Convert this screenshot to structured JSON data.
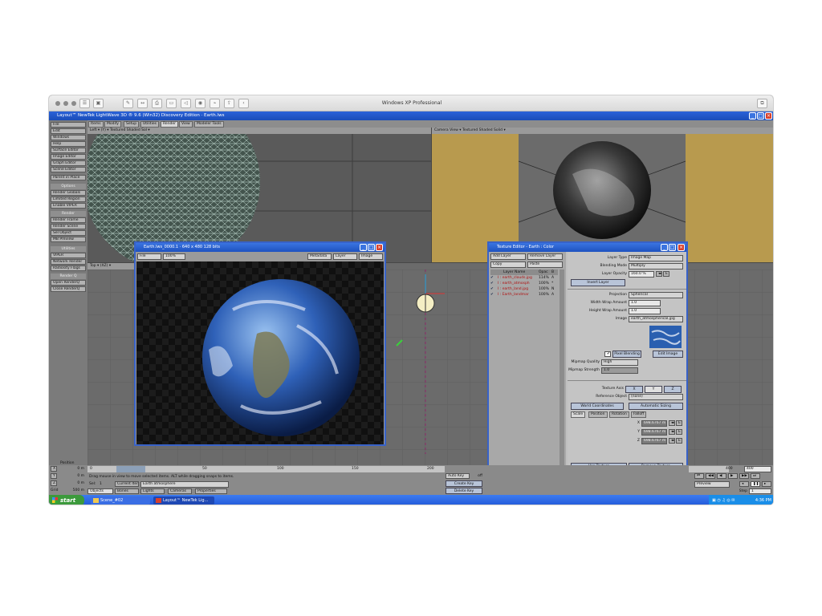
{
  "mac": {
    "title": "Windows XP Professional"
  },
  "app": {
    "title": "Layout™ NewTek LightWave 3D ® 9.6 (Win32) Discovery Edition · Earth.lws"
  },
  "tabs": [
    "Items",
    "Modify",
    "Setup",
    "Utilities",
    "Render",
    "View",
    "Modeler Tools"
  ],
  "sidebar": {
    "menus": [
      "File",
      "Edit",
      "Windows",
      "Help"
    ],
    "edit_items": [
      "Surface Editor",
      "Image Editor",
      "Graph Editor",
      "Scene Editor"
    ],
    "parent_in_place": "Parent in Place",
    "options_header": "Options",
    "options": [
      "Render Globals",
      "Limited Region",
      "Enable VIPER"
    ],
    "render_header": "Render",
    "render": [
      "Render Frame",
      "Render Scene",
      "Sel Object",
      "MB Preview"
    ],
    "utilities_header": "Utilities",
    "utilities": [
      "VIPER",
      "Network Render",
      "Radiosity Flags"
    ],
    "renderq_header": "Render Q",
    "renderq": [
      "Open RenderQ",
      "Close RenderQ"
    ]
  },
  "viewports": {
    "tl_view": "Left",
    "tl_axis": "(Y)",
    "tl_mode": "Textured Shaded Sol",
    "tr_view": "Camera View",
    "tr_mode": "Textured Shaded Solid",
    "bl_view": "Top",
    "bl_axis": "(XZ)"
  },
  "render_window": {
    "title": "Earth.lws_0000.1 · 640 x 480 128 bits",
    "file": "File",
    "zoom": "100%",
    "metadata": "Metadata",
    "layer": "Layer",
    "image": "Image"
  },
  "texture_editor": {
    "title": "Texture Editor - Earth : Color",
    "add_layer": "Add Layer",
    "remove_layer": "Remove Layer",
    "copy": "Copy",
    "paste": "Paste",
    "col_layer": "Layer Name",
    "col_opac": "Opac",
    "col_b": "B",
    "layers": [
      {
        "name": "I : earth_clouds.jpg",
        "opac": "114%",
        "b": "A"
      },
      {
        "name": "I : earth_atmosph",
        "opac": "100%",
        "b": "*"
      },
      {
        "name": "I : earth_land.jpg",
        "opac": "100%",
        "b": "N"
      },
      {
        "name": "I : Earth_landmar",
        "opac": "100%",
        "b": "A"
      }
    ],
    "layer_type_label": "Layer Type",
    "layer_type": "Image Map",
    "blending_label": "Blending Mode",
    "blending": "Multiply",
    "opacity_label": "Layer Opacity",
    "opacity": "160.0 %",
    "invert_layer": "Invert Layer",
    "projection_label": "Projection",
    "projection": "Spherical",
    "width_wrap_label": "Width Wrap Amount",
    "width_wrap": "1.0",
    "height_wrap_label": "Height Wrap Amount",
    "height_wrap": "1.0",
    "image_label": "Image",
    "image": "earth_atmospherical.jpg",
    "pixel_blending": "Pixel Blending",
    "edit_image": "Edit Image",
    "mipmap_q_label": "Mipmap Quality",
    "mipmap_q": "High",
    "mipmap_s_label": "Mipmap Strength",
    "mipmap_s": "1.0",
    "texture_axis_label": "Texture Axis",
    "axis_x": "X",
    "axis_y": "Y",
    "axis_z": "Z",
    "ref_obj_label": "Reference Object",
    "ref_obj": "(none)",
    "world_coords": "World Coordinates",
    "auto_sizing": "Automatic Sizing",
    "subtabs": [
      "Scale",
      "Position",
      "Rotation",
      "Falloff"
    ],
    "scale_x_label": "X",
    "scale_y_label": "Y",
    "scale_z_label": "Z",
    "scale_x": "698.6767 m",
    "scale_y": "698.6767 m",
    "scale_z": "698.6767 m",
    "use_texture": "Use Texture",
    "remove_texture": "Remove Texture"
  },
  "timeline": {
    "position": "Position",
    "ticks": [
      "0",
      "50",
      "100",
      "150",
      "200",
      "400"
    ],
    "end_frame": "400",
    "x_label": "X",
    "y_label": "Y",
    "z_label": "Z",
    "grid_label": "Grid",
    "x_val": "0 m",
    "y_val": "0 m",
    "z_val": "0 m",
    "grid_val": "500 m",
    "status": "Drag mouse in view to move selected items. ALT while dragging snaps to items.",
    "sel": "Sel:",
    "sel_count": "1",
    "current_item_label": "Current Item",
    "current_item": "Earth atmosphere",
    "objects": "Objects",
    "bones": "Bones",
    "lights": "Lights",
    "cameras": "Cameras",
    "properties": "Properties",
    "auto_key": "Auto Key",
    "auto_key_val": "off",
    "create_key": "Create Key",
    "delete_key": "Delete Key",
    "preview": "Preview",
    "step": "Step",
    "step_val": "1"
  },
  "taskbar": {
    "start": "start",
    "items": [
      "Scene_#02",
      "Layout™ NewTek Lig..."
    ],
    "clock": "4:36 PM"
  },
  "colors": {
    "xp_blue": "#2a62d8",
    "xp_start": "#3c9a3c",
    "panel": "#c0c0c0",
    "camera_bg": "#b89a4e"
  }
}
